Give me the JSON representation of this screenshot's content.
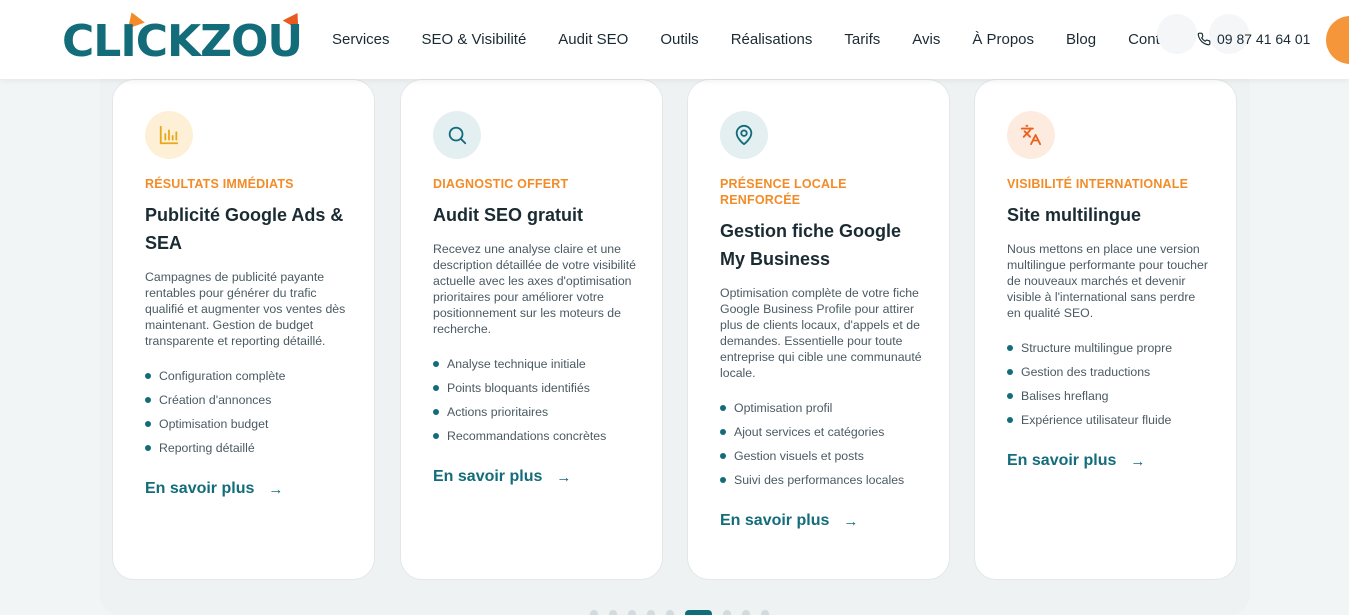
{
  "brand": {
    "logo_text": "CLICKZOU",
    "colors": {
      "primary": "#136c7a",
      "accent": "#f28c28",
      "accent2": "#e85a1f"
    }
  },
  "nav": {
    "items": [
      "Services",
      "SEO & Visibilité",
      "Audit SEO",
      "Outils",
      "Réalisations",
      "Tarifs",
      "Avis",
      "À Propos",
      "Blog",
      "Contact"
    ]
  },
  "header": {
    "phone_icon": "phone-icon",
    "phone": "09 87 41 64 01"
  },
  "cards": [
    {
      "icon": "bar-chart-icon",
      "icon_bg": "#fdf0d6",
      "icon_color": "#e8a81a",
      "eyebrow": "RÉSULTATS IMMÉDIATS",
      "title": "Publicité Google Ads & SEA",
      "description": "Campagnes de publicité payante rentables pour générer du trafic qualifié et augmenter vos ventes dès maintenant. Gestion de budget transparente et reporting détaillé.",
      "features": [
        "Configuration complète",
        "Création d'annonces",
        "Optimisation budget",
        "Reporting détaillé"
      ],
      "link": "En savoir plus"
    },
    {
      "icon": "search-icon",
      "icon_bg": "#e3eff1",
      "icon_color": "#136c7a",
      "eyebrow": "DIAGNOSTIC OFFERT",
      "title": "Audit SEO gratuit",
      "description": "Recevez une analyse claire et une description détaillée de votre visibilité actuelle avec les axes d'optimisation prioritaires pour améliorer votre positionnement sur les moteurs de recherche.",
      "features": [
        "Analyse technique initiale",
        "Points bloquants identifiés",
        "Actions prioritaires",
        "Recommandations concrètes"
      ],
      "link": "En savoir plus"
    },
    {
      "icon": "map-pin-icon",
      "icon_bg": "#e3eff1",
      "icon_color": "#136c7a",
      "eyebrow": "PRÉSENCE LOCALE RENFORCÉE",
      "title": "Gestion fiche Google My Business",
      "description": "Optimisation complète de votre fiche Google Business Profile pour attirer plus de clients locaux, d'appels et de demandes. Essentielle pour toute entreprise qui cible une communauté locale.",
      "features": [
        "Optimisation profil",
        "Ajout services et catégories",
        "Gestion visuels et posts",
        "Suivi des performances locales"
      ],
      "link": "En savoir plus"
    },
    {
      "icon": "translate-icon",
      "icon_bg": "#fdebe0",
      "icon_color": "#e8631f",
      "eyebrow": "VISIBILITÉ INTERNATIONALE",
      "title": "Site multilingue",
      "description": "Nous mettons en place une version multilingue performante pour toucher de nouveaux marchés et devenir visible à l'international sans perdre en qualité SEO.",
      "features": [
        "Structure multilingue propre",
        "Gestion des traductions",
        "Balises hreflang",
        "Expérience utilisateur fluide"
      ],
      "link": "En savoir plus"
    }
  ],
  "pagination": {
    "total": 9,
    "active": 5
  }
}
